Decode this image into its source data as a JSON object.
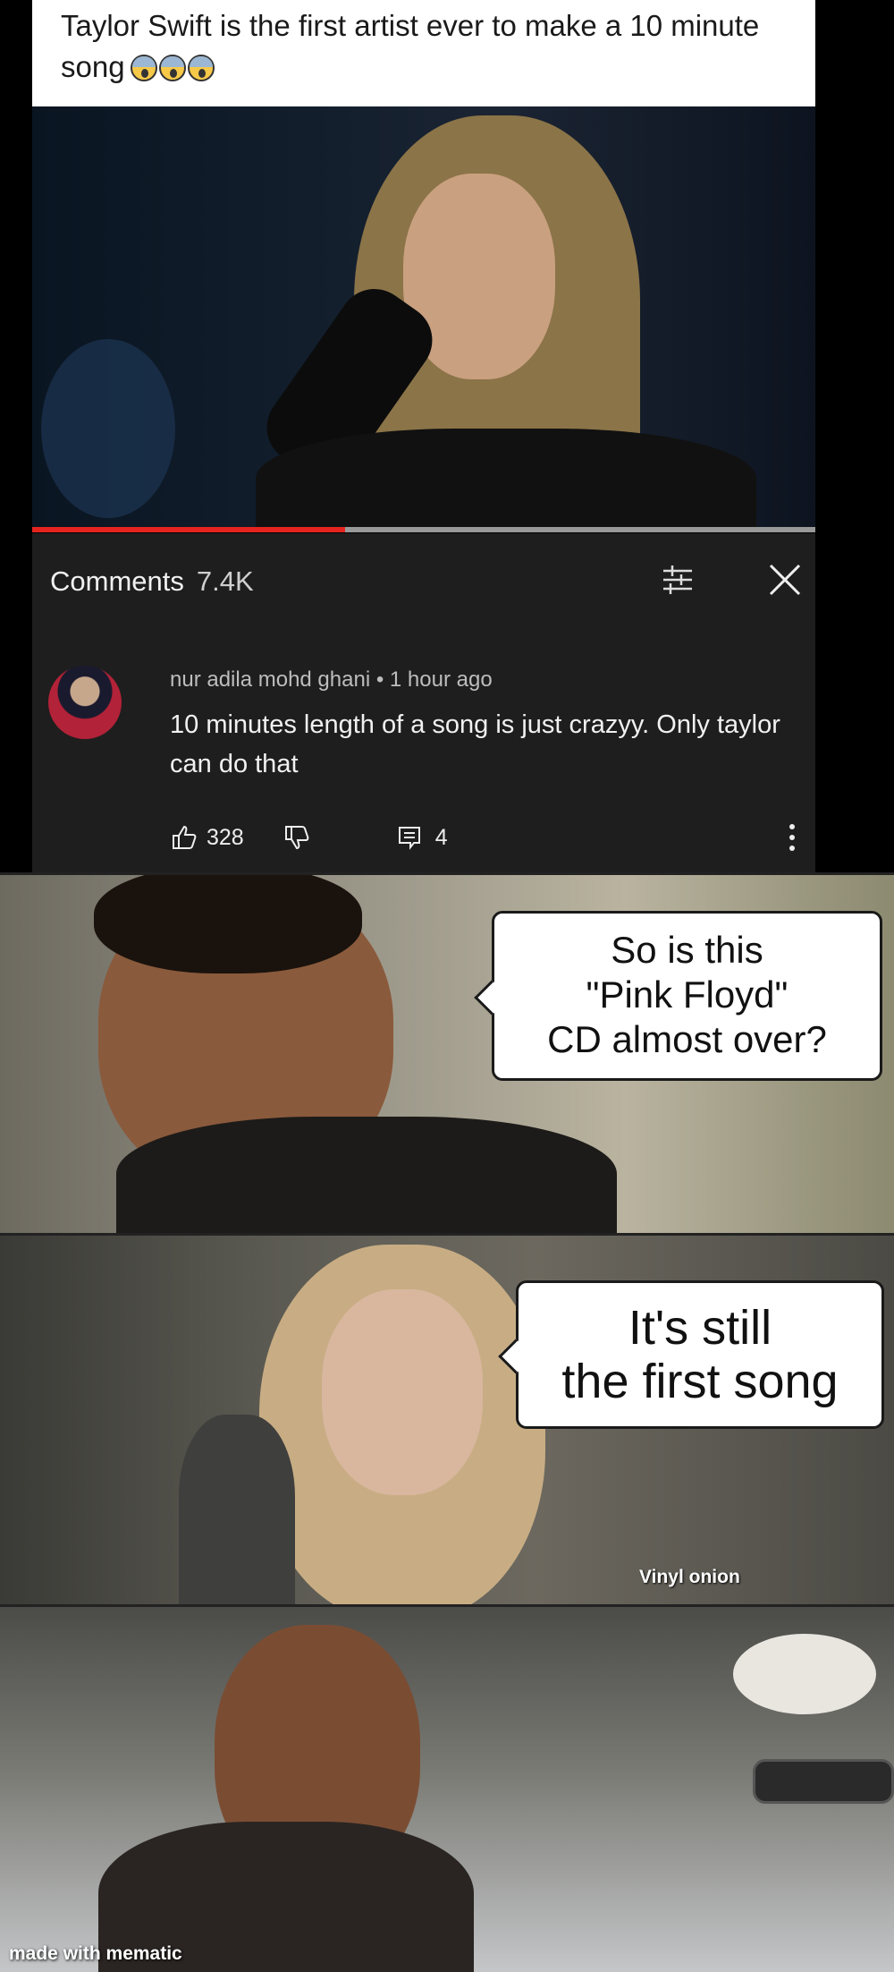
{
  "post": {
    "caption": "Taylor Swift is the first artist ever to make a 10 minute song",
    "caption_emoji": [
      "screaming-face-emoji",
      "screaming-face-emoji",
      "screaming-face-emoji"
    ]
  },
  "video": {
    "progress": 0.4
  },
  "comments": {
    "title": "Comments",
    "count": "7.4K",
    "comment": {
      "author": "nur adila mohd ghani",
      "separator": "•",
      "time": "1 hour ago",
      "text": "10 minutes length of a song is just crazyy. Only taylor can do that",
      "likes": "328",
      "replies": "4"
    }
  },
  "meme": {
    "panel1_bubble": [
      "So is this",
      "\"Pink Floyd\"",
      "CD almost over?"
    ],
    "panel2_bubble": [
      "It's still",
      "the first song"
    ],
    "panel2_watermark": "Vinyl onion",
    "panel3_watermark": "made with mematic"
  },
  "colors": {
    "progress": "#e52420",
    "panel_bg": "#1e1e1e"
  }
}
